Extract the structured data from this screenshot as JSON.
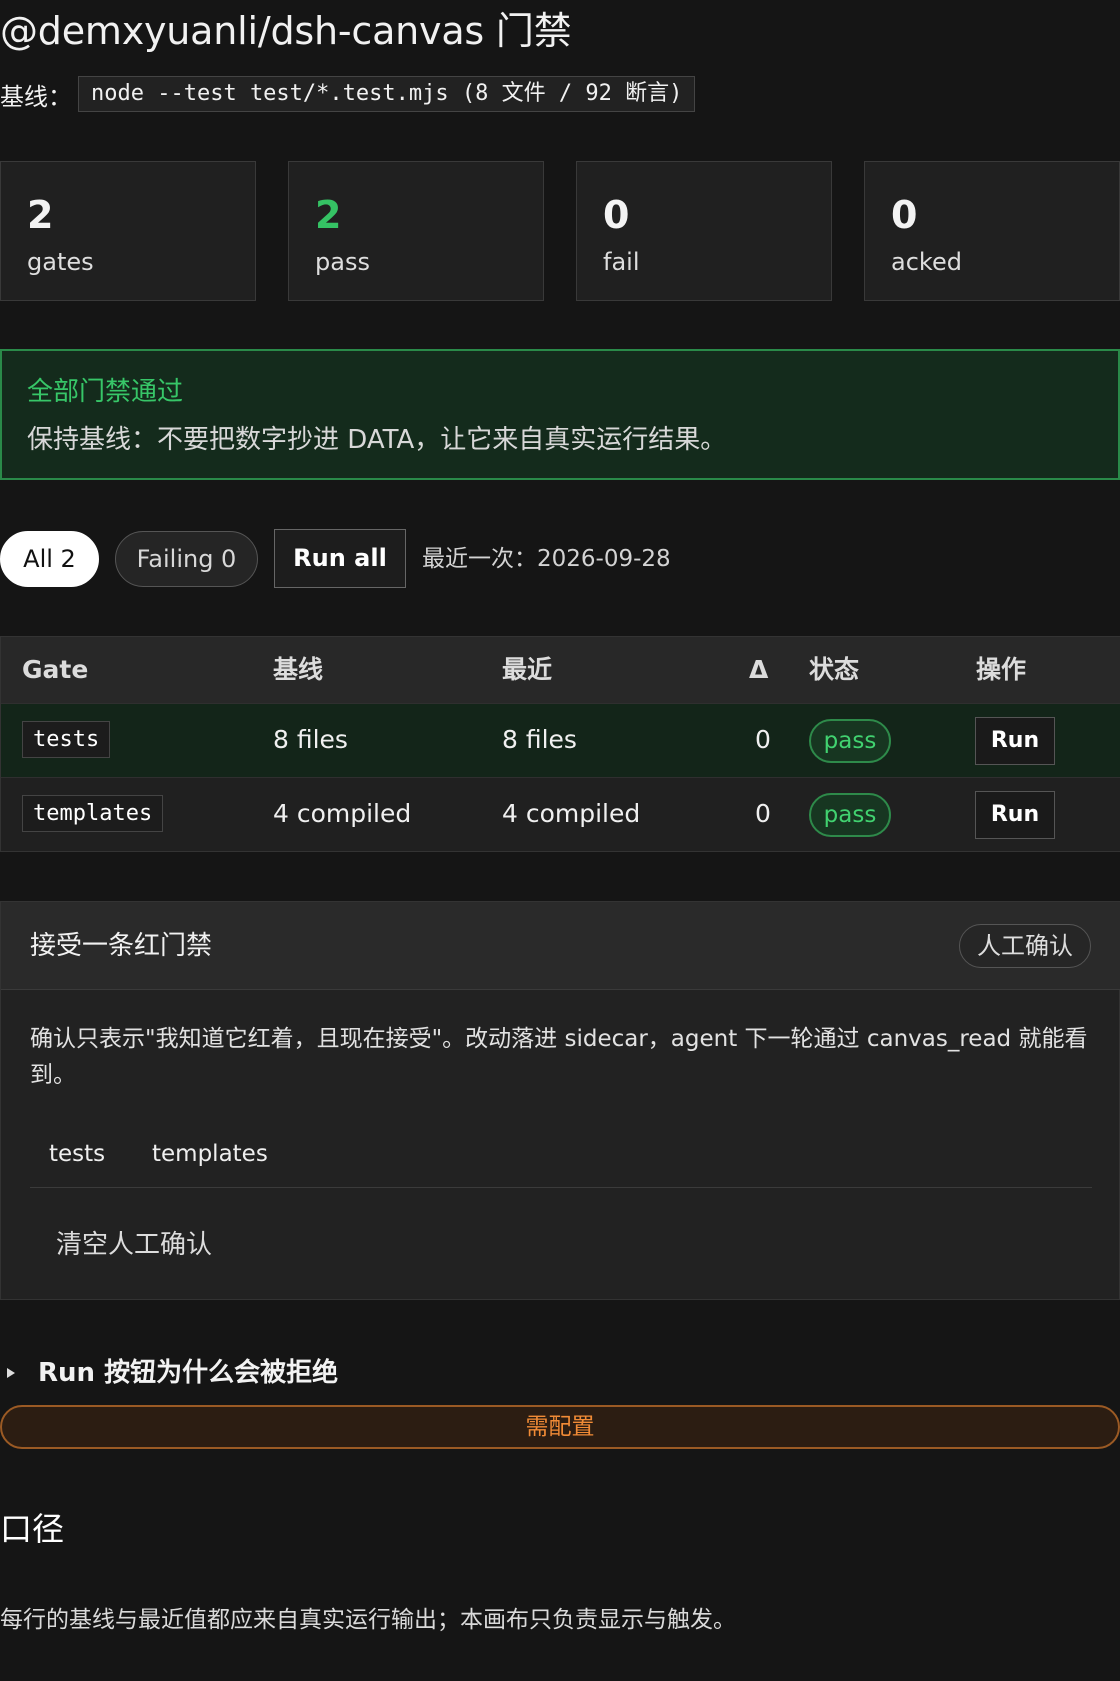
{
  "title": "@demxyuanli/dsh-canvas 门禁",
  "baseline": {
    "label": "基线：",
    "command": "node --test test/*.test.mjs (8 文件 / 92 断言)"
  },
  "stats": [
    {
      "value": "2",
      "label": "gates"
    },
    {
      "value": "2",
      "label": "pass"
    },
    {
      "value": "0",
      "label": "fail"
    },
    {
      "value": "0",
      "label": "acked"
    }
  ],
  "alert": {
    "title": "全部门禁通过",
    "body": "保持基线：不要把数字抄进 DATA，让它来自真实运行结果。",
    "colors": {
      "accent": "#37c668",
      "border": "#2a8a49",
      "background": "#142b1c"
    }
  },
  "filters": {
    "all_label": "All 2",
    "failing_label": "Failing 0"
  },
  "toolbar": {
    "run_all_label": "Run all",
    "last_run": "最近一次：2026-09-28"
  },
  "table": {
    "headers": [
      "Gate",
      "基线",
      "最近",
      "Δ",
      "状态",
      "操作"
    ],
    "rows": [
      {
        "gate": "tests",
        "baseline": "8 files",
        "recent": "8 files",
        "delta": "0",
        "status": "pass",
        "action": "Run"
      },
      {
        "gate": "templates",
        "baseline": "4 compiled",
        "recent": "4 compiled",
        "delta": "0",
        "status": "pass",
        "action": "Run"
      }
    ]
  },
  "ack_panel": {
    "title": "接受一条红门禁",
    "badge": "人工确认",
    "description": "确认只表示\"我知道它红着，且现在接受\"。改动落进 sidecar，agent 下一轮通过 canvas_read 就能看到。",
    "items": [
      "tests",
      "templates"
    ],
    "clear_label": "清空人工确认"
  },
  "details": {
    "summary": "Run 按钮为什么会被拒绝",
    "config_label": "需配置"
  },
  "section": {
    "title": "口径",
    "note": "每行的基线与最近值都应来自真实运行输出；本画布只负责显示与触发。"
  },
  "icons": {
    "disclosure": "disclosure-triangle-icon"
  },
  "colors": {
    "background": "#151515",
    "pass": "#41d270",
    "warning": "#f18b36"
  }
}
